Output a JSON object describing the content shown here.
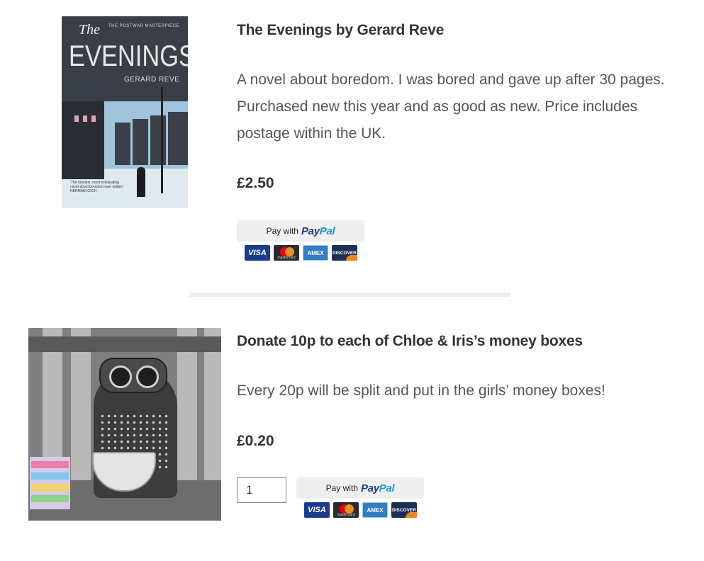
{
  "products": [
    {
      "title": "The Evenings by Gerard Reve",
      "description": "A novel about boredom. I was bored and gave up after 30 pages. Purchased new this year and as good as new. Price includes postage within the UK.",
      "price": "£2.50",
      "image": {
        "series_label": "THE POSTWAR MASTERPIECE",
        "title_small": "The",
        "title_big": "EVENINGS",
        "author": "GERARD REVE",
        "quote": "'The funniest, most exhilarating novel about boredom ever written' HERMAN KOCH"
      }
    },
    {
      "title": "Donate 10p to each of Chloe & Iris’s money boxes",
      "description": "Every 20p will be split and put in the girls’ money boxes!",
      "price": "£0.20",
      "quantity": "1"
    }
  ],
  "paypal": {
    "pay_with": "Pay with",
    "brand_pay": "Pay",
    "brand_pal": "Pal",
    "cards": [
      "VISA",
      "mastercard",
      "AMEX",
      "DISCOVER"
    ]
  },
  "colors": {
    "paypal_dark": "#253b80",
    "paypal_light": "#179bd7",
    "button_bg": "#efefef"
  }
}
